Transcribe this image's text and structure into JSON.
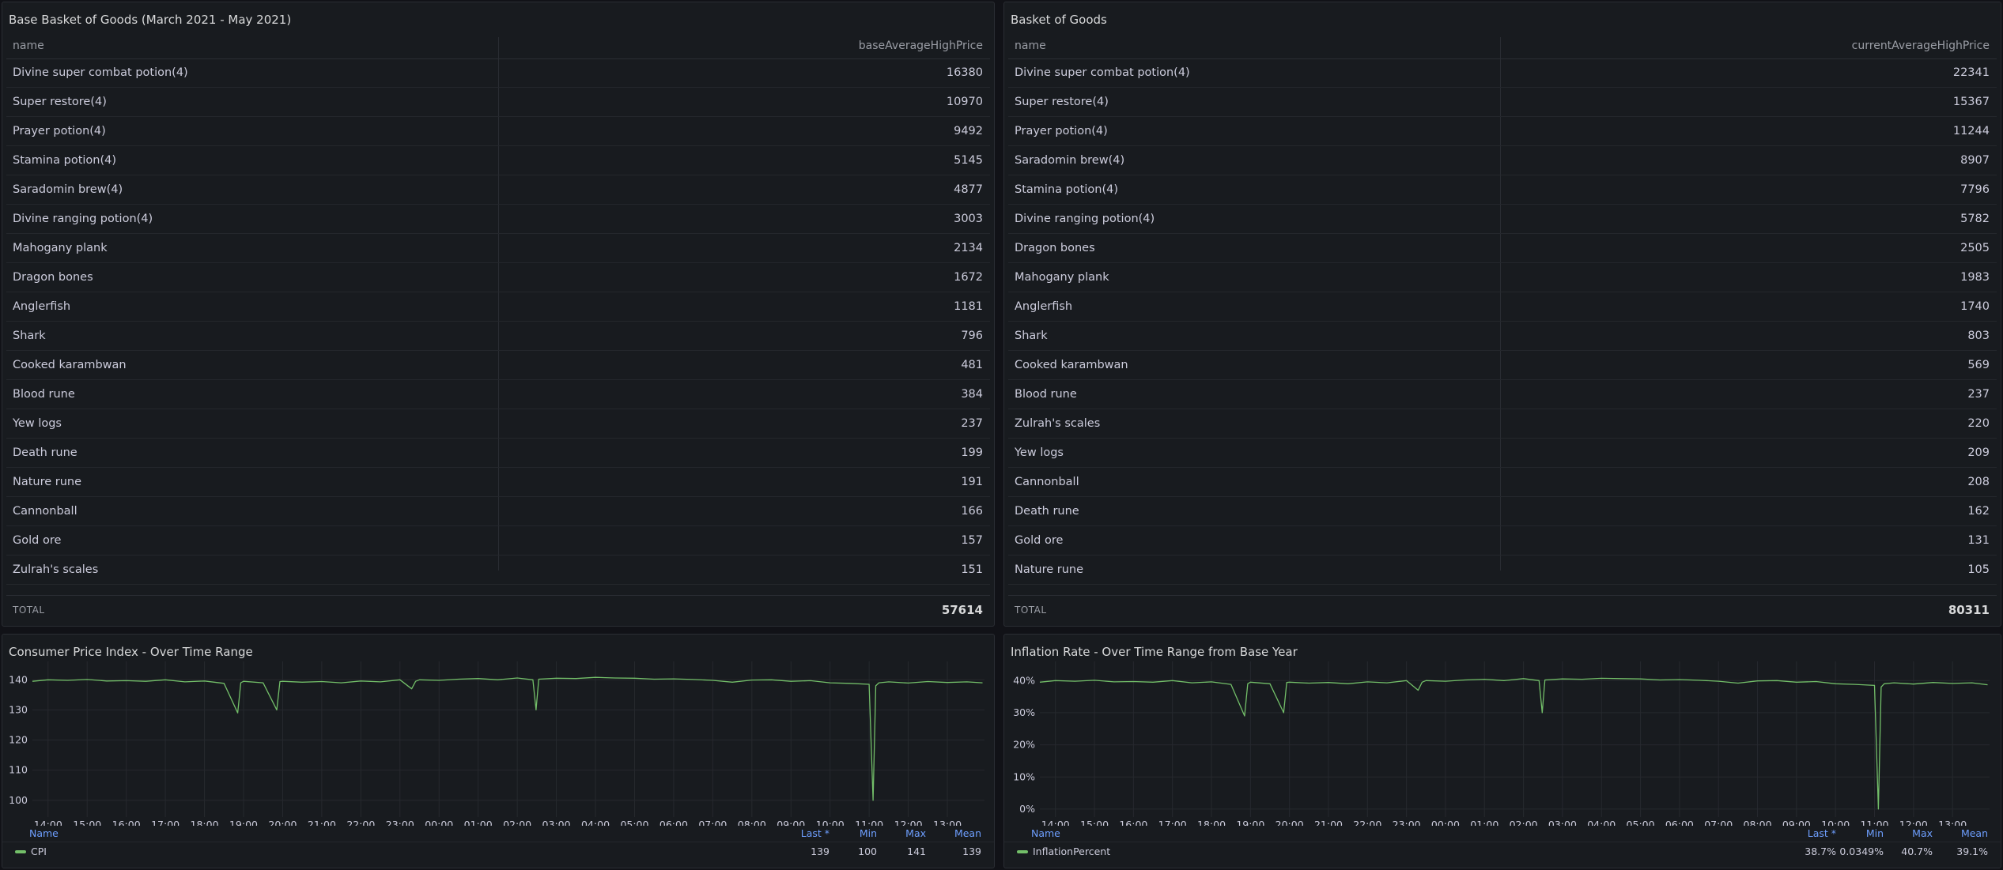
{
  "base_table": {
    "title": "Base Basket of Goods (March 2021 - May 2021)",
    "col_name": "name",
    "col_value": "baseAverageHighPrice",
    "rows": [
      {
        "name": "Divine super combat potion(4)",
        "value": "16380"
      },
      {
        "name": "Super restore(4)",
        "value": "10970"
      },
      {
        "name": "Prayer potion(4)",
        "value": "9492"
      },
      {
        "name": "Stamina potion(4)",
        "value": "5145"
      },
      {
        "name": "Saradomin brew(4)",
        "value": "4877"
      },
      {
        "name": "Divine ranging potion(4)",
        "value": "3003"
      },
      {
        "name": "Mahogany plank",
        "value": "2134"
      },
      {
        "name": "Dragon bones",
        "value": "1672"
      },
      {
        "name": "Anglerfish",
        "value": "1181"
      },
      {
        "name": "Shark",
        "value": "796"
      },
      {
        "name": "Cooked karambwan",
        "value": "481"
      },
      {
        "name": "Blood rune",
        "value": "384"
      },
      {
        "name": "Yew logs",
        "value": "237"
      },
      {
        "name": "Death rune",
        "value": "199"
      },
      {
        "name": "Nature rune",
        "value": "191"
      },
      {
        "name": "Cannonball",
        "value": "166"
      },
      {
        "name": "Gold ore",
        "value": "157"
      },
      {
        "name": "Zulrah's scales",
        "value": "151"
      }
    ],
    "total_label": "TOTAL",
    "total_value": "57614"
  },
  "current_table": {
    "title": "Basket of Goods",
    "col_name": "name",
    "col_value": "currentAverageHighPrice",
    "rows": [
      {
        "name": "Divine super combat potion(4)",
        "value": "22341"
      },
      {
        "name": "Super restore(4)",
        "value": "15367"
      },
      {
        "name": "Prayer potion(4)",
        "value": "11244"
      },
      {
        "name": "Saradomin brew(4)",
        "value": "8907"
      },
      {
        "name": "Stamina potion(4)",
        "value": "7796"
      },
      {
        "name": "Divine ranging potion(4)",
        "value": "5782"
      },
      {
        "name": "Dragon bones",
        "value": "2505"
      },
      {
        "name": "Mahogany plank",
        "value": "1983"
      },
      {
        "name": "Anglerfish",
        "value": "1740"
      },
      {
        "name": "Shark",
        "value": "803"
      },
      {
        "name": "Cooked karambwan",
        "value": "569"
      },
      {
        "name": "Blood rune",
        "value": "237"
      },
      {
        "name": "Zulrah's scales",
        "value": "220"
      },
      {
        "name": "Yew logs",
        "value": "209"
      },
      {
        "name": "Cannonball",
        "value": "208"
      },
      {
        "name": "Death rune",
        "value": "162"
      },
      {
        "name": "Gold ore",
        "value": "131"
      },
      {
        "name": "Nature rune",
        "value": "105"
      }
    ],
    "total_label": "TOTAL",
    "total_value": "80311"
  },
  "cpi_panel": {
    "title": "Consumer Price Index - Over Time Range",
    "legend": {
      "col_name": "Name",
      "col_last": "Last *",
      "col_min": "Min",
      "col_max": "Max",
      "col_mean": "Mean",
      "series_name": "CPI",
      "last": "139",
      "min": "100",
      "max": "141",
      "mean": "139"
    }
  },
  "inflation_panel": {
    "title": "Inflation Rate - Over Time Range from Base Year",
    "legend": {
      "col_name": "Name",
      "col_last": "Last *",
      "col_min": "Min",
      "col_max": "Max",
      "col_mean": "Mean",
      "series_name": "InflationPercent",
      "last": "38.7%",
      "min": "0.0349%",
      "max": "40.7%",
      "mean": "39.1%"
    }
  },
  "chart_data": [
    {
      "type": "line",
      "title": "Consumer Price Index - Over Time Range",
      "x_ticks": [
        "14:00",
        "15:00",
        "16:00",
        "17:00",
        "18:00",
        "19:00",
        "20:00",
        "21:00",
        "22:00",
        "23:00",
        "00:00",
        "01:00",
        "02:00",
        "03:00",
        "04:00",
        "05:00",
        "06:00",
        "07:00",
        "08:00",
        "09:00",
        "10:00",
        "11:00",
        "12:00",
        "13:00"
      ],
      "y_ticks": [
        "100",
        "110",
        "120",
        "130",
        "140"
      ],
      "ylim": [
        96,
        144
      ],
      "series_color": "#73bf69",
      "series": [
        {
          "name": "CPI",
          "x": [
            13.6,
            14.0,
            14.5,
            15.0,
            15.5,
            16.0,
            16.5,
            17.0,
            17.5,
            18.0,
            18.5,
            18.85,
            18.93,
            19.0,
            19.5,
            19.85,
            19.93,
            20.0,
            20.5,
            21.0,
            21.5,
            22.0,
            22.5,
            23.0,
            23.3,
            23.4,
            23.5,
            24.0,
            24.5,
            25.0,
            25.5,
            26.0,
            26.4,
            26.48,
            26.55,
            27.0,
            27.5,
            28.0,
            28.5,
            29.0,
            29.5,
            30.0,
            30.5,
            31.0,
            31.5,
            32.0,
            32.5,
            33.0,
            33.5,
            34.0,
            34.5,
            35.0,
            35.1,
            35.17,
            35.25,
            35.5,
            36.0,
            36.5,
            37.0,
            37.5,
            37.9
          ],
          "y": [
            139.5,
            140,
            139.8,
            140.1,
            139.6,
            139.7,
            139.5,
            140,
            139.3,
            139.6,
            138.8,
            129,
            139,
            139.5,
            139,
            130,
            139.4,
            139.5,
            139.2,
            139.4,
            139,
            139.6,
            139.3,
            140,
            137,
            139.5,
            140,
            139.8,
            140.2,
            140.4,
            140,
            140.6,
            140,
            130,
            140.2,
            140.5,
            140.4,
            140.8,
            140.6,
            140.5,
            140.2,
            140.3,
            140.1,
            139.8,
            139.2,
            139.9,
            140,
            139.5,
            139.7,
            139,
            138.8,
            138.5,
            100,
            138,
            139,
            139.3,
            138.9,
            139.4,
            139.1,
            139.3,
            139
          ]
        }
      ]
    },
    {
      "type": "line",
      "title": "Inflation Rate - Over Time Range from Base Year",
      "x_ticks": [
        "14:00",
        "15:00",
        "16:00",
        "17:00",
        "18:00",
        "19:00",
        "20:00",
        "21:00",
        "22:00",
        "23:00",
        "00:00",
        "01:00",
        "02:00",
        "03:00",
        "04:00",
        "05:00",
        "06:00",
        "07:00",
        "08:00",
        "09:00",
        "10:00",
        "11:00",
        "12:00",
        "13:00"
      ],
      "y_ticks": [
        "0%",
        "10%",
        "20%",
        "30%",
        "40%"
      ],
      "ylim": [
        -1,
        44
      ],
      "series_color": "#73bf69",
      "series": [
        {
          "name": "InflationPercent",
          "x": [
            13.6,
            14.0,
            14.5,
            15.0,
            15.5,
            16.0,
            16.5,
            17.0,
            17.5,
            18.0,
            18.5,
            18.85,
            18.93,
            19.0,
            19.5,
            19.85,
            19.93,
            20.0,
            20.5,
            21.0,
            21.5,
            22.0,
            22.5,
            23.0,
            23.3,
            23.4,
            23.5,
            24.0,
            24.5,
            25.0,
            25.5,
            26.0,
            26.4,
            26.48,
            26.55,
            27.0,
            27.5,
            28.0,
            28.5,
            29.0,
            29.5,
            30.0,
            30.5,
            31.0,
            31.5,
            32.0,
            32.5,
            33.0,
            33.5,
            34.0,
            34.5,
            35.0,
            35.1,
            35.17,
            35.25,
            35.5,
            36.0,
            36.5,
            37.0,
            37.5,
            37.9
          ],
          "y": [
            39.5,
            40,
            39.8,
            40.1,
            39.6,
            39.7,
            39.5,
            40,
            39.3,
            39.6,
            38.8,
            29,
            39,
            39.5,
            39,
            30,
            39.4,
            39.5,
            39.2,
            39.4,
            39,
            39.6,
            39.3,
            40,
            37,
            39.5,
            40,
            39.8,
            40.2,
            40.4,
            40,
            40.6,
            40,
            30,
            40.2,
            40.5,
            40.4,
            40.7,
            40.6,
            40.5,
            40.2,
            40.3,
            40.1,
            39.8,
            39.2,
            39.9,
            40,
            39.5,
            39.7,
            39,
            38.8,
            38.5,
            0.0349,
            38,
            39,
            39.3,
            38.9,
            39.4,
            39.1,
            39.3,
            38.7
          ]
        }
      ]
    }
  ]
}
